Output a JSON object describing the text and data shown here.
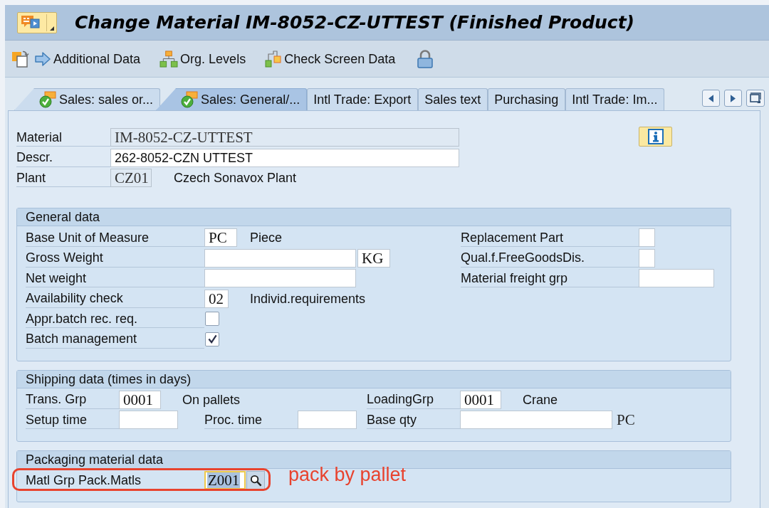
{
  "window": {
    "title": "Change Material IM-8052-CZ-UTTEST (Finished Product)"
  },
  "toolbar": {
    "buttons": [
      {
        "label": "Additional Data"
      },
      {
        "label": "Org. Levels"
      },
      {
        "label": "Check Screen Data"
      }
    ]
  },
  "tabs": [
    {
      "label": "Sales: sales or...",
      "selected": false,
      "maintained": true
    },
    {
      "label": "Sales: General/...",
      "selected": true,
      "maintained": true
    },
    {
      "label": "Intl Trade: Export",
      "selected": false,
      "maintained": false
    },
    {
      "label": "Sales text",
      "selected": false,
      "maintained": false
    },
    {
      "label": "Purchasing",
      "selected": false,
      "maintained": false
    },
    {
      "label": "Intl Trade: Im...",
      "selected": false,
      "maintained": false
    }
  ],
  "header": {
    "fields": [
      {
        "label": "Material",
        "kind": "input",
        "value": "IM-8052-CZ-UTTEST",
        "disabled": true
      },
      {
        "label": "Descr.",
        "kind": "text",
        "value": "262-8052-CZN UTTEST",
        "disabled": false
      },
      {
        "label": "Plant",
        "kind": "input",
        "value": "CZ01",
        "disabled": true,
        "description": "Czech Sonavox Plant"
      }
    ]
  },
  "general_data": {
    "title": "General data",
    "left": [
      {
        "label": "Base Unit of Measure",
        "kind": "input",
        "value": "PC",
        "description": "Piece"
      },
      {
        "label": "Gross Weight",
        "kind": "input",
        "unit": {
          "text": "KG",
          "boxed": true
        }
      },
      {
        "label": "Net weight",
        "kind": "input"
      },
      {
        "label": "Availability check",
        "kind": "input",
        "value": "02",
        "description": "Individ.requirements"
      },
      {
        "label": "Appr.batch rec. req.",
        "kind": "checkbox",
        "checked": false
      },
      {
        "label": "Batch management",
        "kind": "checkbox",
        "checked": true
      }
    ],
    "right": [
      {
        "label": "Replacement Part",
        "kind": "input"
      },
      {
        "label": "Qual.f.FreeGoodsDis.",
        "kind": "input"
      },
      {
        "label": "Material freight grp",
        "kind": "input"
      }
    ]
  },
  "shipping_data": {
    "title": "Shipping data (times in days)",
    "rows": [
      [
        {
          "label": "Trans. Grp",
          "kind": "input",
          "value": "0001",
          "description": "On pallets"
        },
        null,
        {
          "label": "LoadingGrp",
          "kind": "input",
          "value": "0001",
          "description": "Crane"
        }
      ],
      [
        {
          "label": "Setup time",
          "kind": "input"
        },
        {
          "label": "Proc. time",
          "kind": "input"
        },
        {
          "label": "Base qty",
          "kind": "input",
          "unit": {
            "text": "PC",
            "boxed": false
          }
        }
      ]
    ]
  },
  "packaging": {
    "title": "Packaging material data",
    "rows": [
      {
        "label": "Matl Grp Pack.Matls",
        "kind": "input",
        "value": "Z001",
        "focused": true,
        "search_help": true
      }
    ],
    "annotation": {
      "text": "pack by pallet",
      "framed": true
    }
  }
}
